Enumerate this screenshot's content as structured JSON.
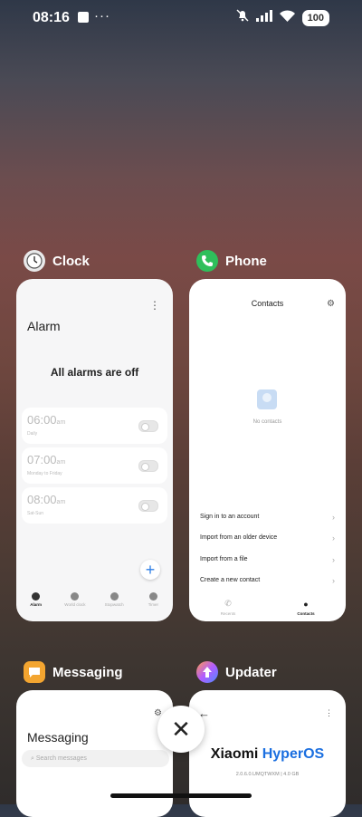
{
  "status_bar": {
    "time": "08:16",
    "dots": "···",
    "battery": "100"
  },
  "recents": {
    "clock": {
      "app_name": "Clock",
      "screen_title": "Alarm",
      "empty_message": "All alarms are off",
      "alarms": [
        {
          "time": "06:00",
          "ampm": "am",
          "label": "Daily",
          "enabled": false
        },
        {
          "time": "07:00",
          "ampm": "am",
          "label": "Monday to Friday",
          "enabled": false
        },
        {
          "time": "08:00",
          "ampm": "am",
          "label": "Sat-Sun",
          "enabled": false
        }
      ],
      "add_icon": "+",
      "tabs": [
        "Alarm",
        "World clock",
        "Stopwatch",
        "Timer"
      ]
    },
    "phone": {
      "app_name": "Phone",
      "screen_title": "Contacts",
      "empty_message": "No contacts",
      "options": [
        "Sign in to an account",
        "Import from an older device",
        "Import from a file",
        "Create a new contact"
      ],
      "tabs": [
        "Recents",
        "Contacts"
      ]
    },
    "messaging": {
      "app_name": "Messaging",
      "screen_title": "Messaging",
      "search_placeholder": "Search messages"
    },
    "updater": {
      "app_name": "Updater",
      "os_name_part1": "Xiaomi",
      "os_name_part2": "HyperOS",
      "version": "2.0.6.0.UMQTWXM | 4.0 GB"
    }
  },
  "close_all_icon": "✕",
  "icons": {
    "clock": "clock-icon",
    "phone": "phone-icon",
    "messaging": "messaging-icon",
    "updater": "updater-icon"
  },
  "colors": {
    "accent_blue": "#1b6fe0",
    "phone_green": "#2fbf5b"
  }
}
